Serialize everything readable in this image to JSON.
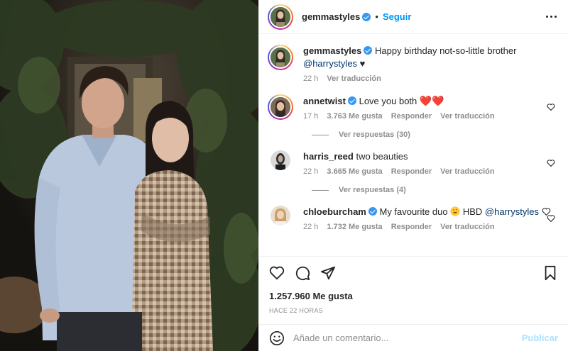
{
  "post": {
    "author": "gemmastyles",
    "follow_label": "Seguir",
    "dot": "•",
    "caption": {
      "user": "gemmastyles",
      "text": "Happy birthday not-so-little brother",
      "mention": "@harrystyles",
      "suffix": " ♥",
      "time": "22 h",
      "translate": "Ver traducción"
    }
  },
  "comments": [
    {
      "user": "annetwist",
      "text": "Love you both",
      "emoji": "❤️❤️",
      "time": "17 h",
      "likes": "3.763 Me gusta",
      "reply": "Responder",
      "translate": "Ver traducción",
      "replies": "Ver respuestas (30)"
    },
    {
      "user": "harris_reed",
      "text": "two beauties",
      "time": "22 h",
      "likes": "3.665 Me gusta",
      "reply": "Responder",
      "translate": "Ver traducción",
      "replies": "Ver respuestas (4)"
    },
    {
      "user": "chloeburcham",
      "text": "My favourite duo",
      "text2": "HBD",
      "mention": "@harrystyles",
      "time": "22 h",
      "likes": "1.732 Me gusta",
      "reply": "Responder",
      "translate": "Ver traducción"
    }
  ],
  "footer": {
    "likes": "1.257.960 Me gusta",
    "timestamp": "HACE 22 HORAS",
    "comment_placeholder": "Añade un comentario...",
    "publish": "Publicar"
  },
  "colors": {
    "accent": "#0095f6",
    "verified": "#3897f0",
    "muted": "#8e8e8e"
  }
}
